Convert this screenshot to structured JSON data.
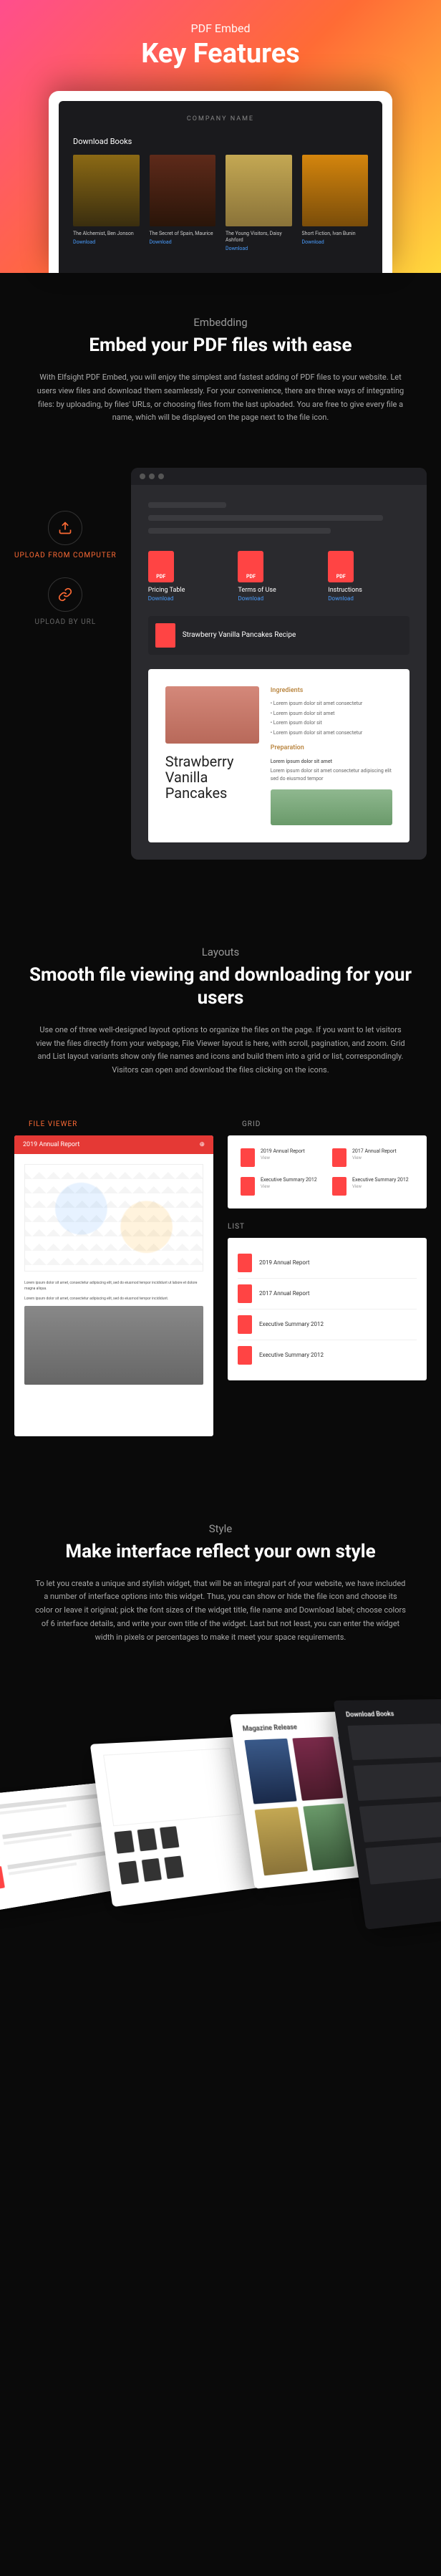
{
  "hero": {
    "label": "PDF Embed",
    "title": "Key Features"
  },
  "laptop": {
    "company": "COMPANY NAME",
    "downloadLabel": "Download Books",
    "books": [
      {
        "title": "The Alchemist, Ben Jonson",
        "link": "Download"
      },
      {
        "title": "The Secret of Spain, Maurice",
        "link": "Download"
      },
      {
        "title": "The Young Visitors, Daisy Ashford",
        "link": "Download"
      },
      {
        "title": "Short Fiction, Ivan Bunin",
        "link": "Download"
      }
    ]
  },
  "embedding": {
    "label": "Embedding",
    "title": "Embed your PDF files with ease",
    "desc": "With Elfsight PDF Embed, you will enjoy the simplest and fastest adding of PDF files to your website. Let users view files and download them seamlessly. For your convenience, there are three ways of integrating files: by uploading, by files' URLs, or choosing files from the last uploaded. You are free to give every file a name, which will be displayed on the page next to the file icon.",
    "sideA": "UPLOAD FROM COMPUTER",
    "sideB": "UPLOAD BY URL",
    "files": [
      {
        "name": "Pricing Table",
        "dl": "Download"
      },
      {
        "name": "Terms of Use",
        "dl": "Download"
      },
      {
        "name": "Instructions",
        "dl": "Download"
      }
    ],
    "recipe": "Strawberry Vanilla Pancakes Recipe",
    "previewTitle1": "Strawberry",
    "previewTitle2": "Vanilla",
    "previewTitle3": "Pancakes",
    "ingredients": "Ingredients",
    "preparation": "Preparation",
    "prepStep": "Lorem ipsum dolor sit amet"
  },
  "layouts": {
    "label": "Layouts",
    "title": "Smooth file viewing and downloading for your users",
    "desc": "Use one of three well-designed layout options to organize the files on the page. If you want to let visitors view the files directly from your webpage, File Viewer layout is here, with scroll, pagination, and zoom. Grid and List layout variants show only file names and icons and build them into a grid or list, correspondingly. Visitors can open and download the files clicking on the icons.",
    "tabFV": "FILE VIEWER",
    "tabGrid": "GRID",
    "tabList": "LIST",
    "fvTitle": "2019 Annual Report",
    "gridItems": [
      {
        "t": "2019 Annual Report",
        "s": "View"
      },
      {
        "t": "2017 Annual Report",
        "s": "View"
      },
      {
        "t": "Executive Summary 2012",
        "s": "View"
      },
      {
        "t": "Executive Summary 2012",
        "s": "View"
      }
    ],
    "listItems": [
      "2019 Annual Report",
      "2017 Annual Report",
      "Executive Summary 2012",
      "Executive Summary 2012"
    ]
  },
  "style": {
    "label": "Style",
    "title": "Make interface reflect your own style",
    "desc": "To let you create a unique and stylish widget, that will be an integral part of your website, we have included a number of interface options into this widget. Thus, you can show or hide the file icon and choose its color or leave it original; pick the font sizes of the widget title, file name and Download label; choose colors of 6 interface details, and write your own title of the widget. Last but not least, you can enter the widget width in pixels or percentages to make it meet your space requirements.",
    "card2Title": "Magazine Release",
    "card4Title": "Download Books"
  }
}
